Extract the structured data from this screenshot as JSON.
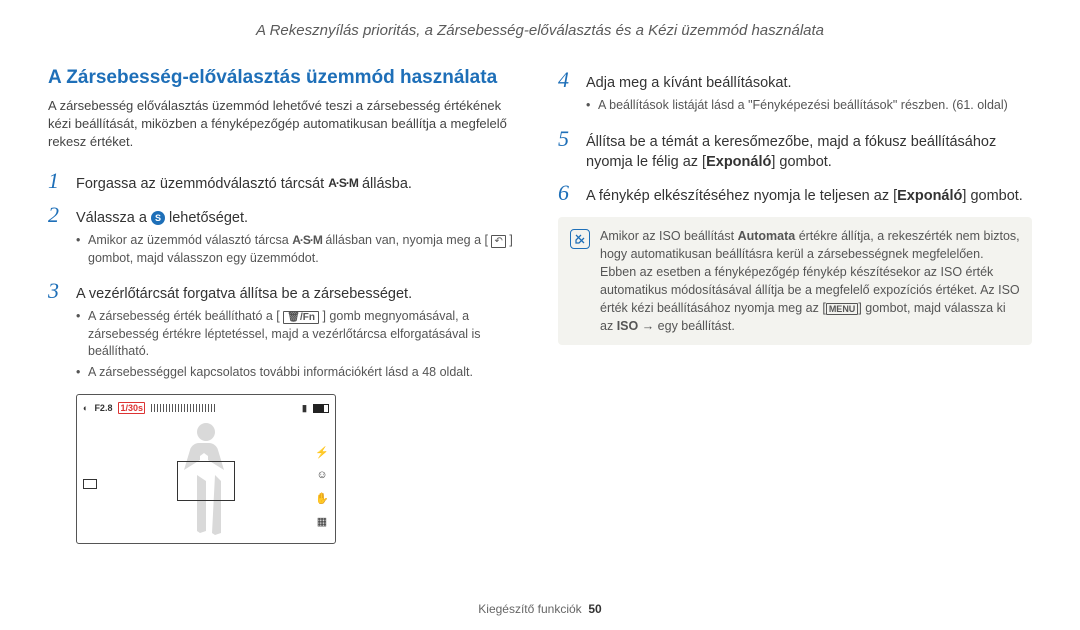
{
  "header": "A Rekesznyílás prioritás, a Zársebesség-előválasztás és a Kézi üzemmód használata",
  "section_title": "A Zársebesség-előválasztás üzemmód használata",
  "intro": "A zársebesség előválasztás üzemmód lehetővé teszi a zársebesség értékének kézi beállítását, miközben a fényképezőgép automatikusan beállítja a megfelelő rekesz értéket.",
  "left_steps": [
    {
      "num": "1",
      "text_a": "Forgassa az üzemmódválasztó tárcsát ",
      "icon": "asm",
      "text_b": " állásba."
    },
    {
      "num": "2",
      "text_a": "Válassza a ",
      "icon": "globe-s",
      "text_b": " lehetőséget.",
      "bullets": [
        {
          "a": "Amikor az üzemmód választó tárcsa ",
          "icon": "asm",
          "b": " állásban van, nyomja meg a [",
          "icon2": "reverse",
          "c": "] gombot, majd válasszon egy üzemmódot."
        }
      ]
    },
    {
      "num": "3",
      "text_a": "A vezérlőtárcsát forgatva állítsa be a zársebességet.",
      "bullets_plain": [
        {
          "a": "A zársebesség érték beállítható a [",
          "icon": "trash-fn",
          "b": "] gomb megnyomásával, a zársebesség értékre léptetéssel, majd a vezérlőtárcsa elforgatásával is beállítható."
        },
        {
          "plain": "A zársebességgel kapcsolatos további információkért lásd a 48 oldalt."
        }
      ]
    }
  ],
  "right_steps": [
    {
      "num": "4",
      "text_a": "Adja meg a kívánt beállításokat.",
      "bullets_plain": [
        {
          "plain": "A beállítások listáját lásd a \"Fényképezési beállítások\" részben. (61. oldal)"
        }
      ]
    },
    {
      "num": "5",
      "text_a": "Állítsa be a témát a keresőmezőbe, majd a fókusz beállításához nyomja le félig az [",
      "bold": "Exponáló",
      "text_b": "] gombot."
    },
    {
      "num": "6",
      "text_a": "A fénykép elkészítéséhez nyomja le teljesen az [",
      "bold": "Exponáló",
      "text_b": "] gombot."
    }
  ],
  "note": {
    "a": "Amikor az ISO beállítást ",
    "bold1": "Automata",
    "b": " értékre állítja, a rekeszérték nem biztos, hogy automatikusan beállításra kerül a zársebességnek megfelelően. Ebben az esetben a fényképezőgép fénykép készítésekor az ISO érték automatikus módosításával állítja be a megfelelő expozíciós értéket. Az ISO érték kézi beállításához nyomja meg az [",
    "menu": "MENU",
    "c": "] gombot, majd válassza ki az ",
    "bold2": "ISO",
    "d": " → egy beállítást."
  },
  "screenshot": {
    "f": "F2.8",
    "shutter": "1/30s"
  },
  "footer": {
    "section": "Kiegészítő funkciók",
    "page": "50"
  },
  "icons": {
    "asm": "A·S·M",
    "globe_s": "S",
    "trash_fn": "🗑/Fn",
    "reverse": "↶"
  }
}
